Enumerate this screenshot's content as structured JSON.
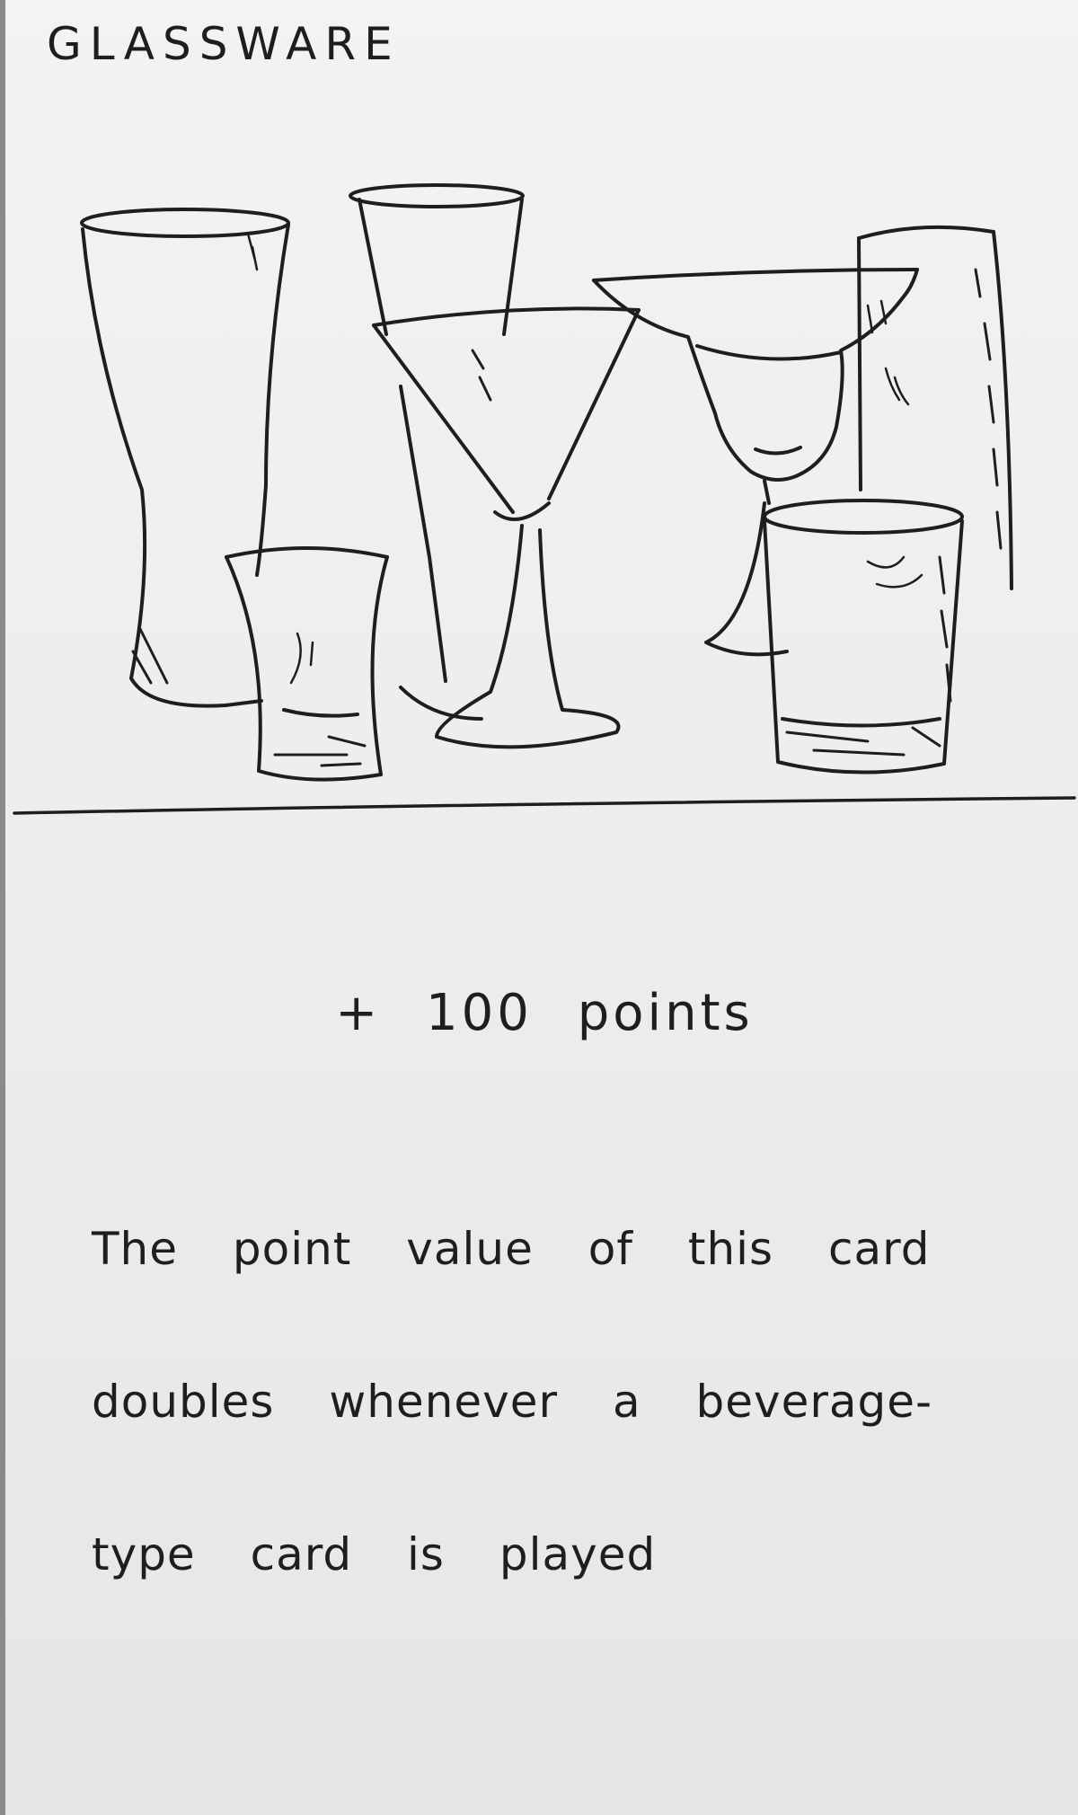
{
  "card": {
    "title": "GLASSWARE",
    "points_text": "+ 100 points",
    "description": "The point value of this card doubles whenever a beverage-type card is played"
  },
  "illustration": {
    "subject": "glassware-drawing",
    "items": [
      "pint-glass",
      "shot-glass",
      "champagne-flute",
      "martini-glass",
      "margarita-glass",
      "highball-glass",
      "rocks-glass"
    ]
  },
  "colors": {
    "ink": "#1e1e1e",
    "paper": "#efefef",
    "card_edge": "#8a8a8a"
  }
}
